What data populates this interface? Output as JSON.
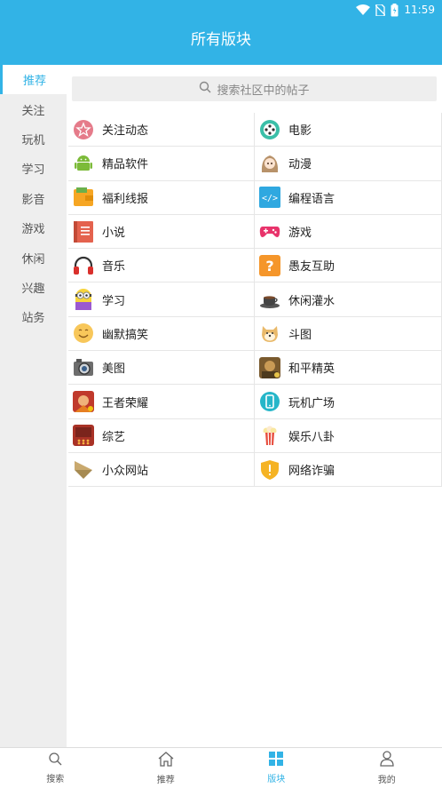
{
  "status_bar": {
    "time": "11:59",
    "icons": [
      "wifi-icon",
      "no-sim-icon",
      "battery-icon"
    ]
  },
  "header": {
    "title": "所有版块",
    "color": "#32b3e6"
  },
  "sidebar": {
    "items": [
      {
        "label": "推荐",
        "active": true
      },
      {
        "label": "关注"
      },
      {
        "label": "玩机"
      },
      {
        "label": "学习"
      },
      {
        "label": "影音"
      },
      {
        "label": "游戏"
      },
      {
        "label": "休闲"
      },
      {
        "label": "兴趣"
      },
      {
        "label": "站务"
      }
    ]
  },
  "search": {
    "placeholder": "搜索社区中的帖子"
  },
  "boards": [
    {
      "label": "关注动态",
      "icon": "star-badge-icon"
    },
    {
      "label": "电影",
      "icon": "film-reel-icon"
    },
    {
      "label": "精品软件",
      "icon": "android-icon"
    },
    {
      "label": "动漫",
      "icon": "anime-girl-icon"
    },
    {
      "label": "福利线报",
      "icon": "wallet-icon"
    },
    {
      "label": "编程语言",
      "icon": "code-icon"
    },
    {
      "label": "小说",
      "icon": "book-icon"
    },
    {
      "label": "游戏",
      "icon": "gamepad-icon"
    },
    {
      "label": "音乐",
      "icon": "headphones-icon"
    },
    {
      "label": "愚友互助",
      "icon": "question-icon"
    },
    {
      "label": "学习",
      "icon": "minion-icon"
    },
    {
      "label": "休闲灌水",
      "icon": "coffee-cup-icon"
    },
    {
      "label": "幽默搞笑",
      "icon": "smiley-icon"
    },
    {
      "label": "斗图",
      "icon": "doge-icon"
    },
    {
      "label": "美图",
      "icon": "camera-icon"
    },
    {
      "label": "和平精英",
      "icon": "peace-elite-icon"
    },
    {
      "label": "王者荣耀",
      "icon": "honor-of-kings-icon"
    },
    {
      "label": "玩机广场",
      "icon": "phone-icon"
    },
    {
      "label": "综艺",
      "icon": "variety-show-icon"
    },
    {
      "label": "娱乐八卦",
      "icon": "popcorn-icon"
    },
    {
      "label": "小众网站",
      "icon": "paper-plane-icon"
    },
    {
      "label": "网络诈骗",
      "icon": "warning-shield-icon"
    }
  ],
  "tabbar": {
    "items": [
      {
        "label": "搜索",
        "icon": "search-icon"
      },
      {
        "label": "推荐",
        "icon": "home-icon"
      },
      {
        "label": "版块",
        "icon": "grid-icon",
        "active": true
      },
      {
        "label": "我的",
        "icon": "user-icon"
      }
    ]
  }
}
